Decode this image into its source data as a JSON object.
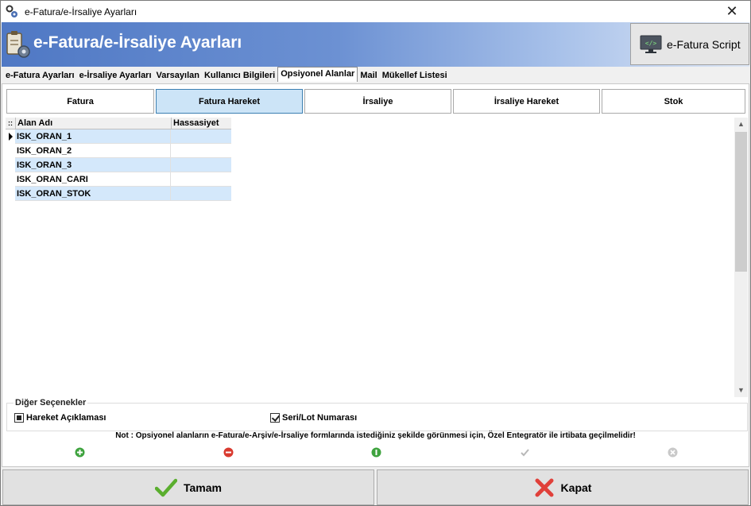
{
  "window": {
    "title": "e-Fatura/e-İrsaliye Ayarları",
    "close_label": "✕"
  },
  "header": {
    "title": "e-Fatura/e-İrsaliye Ayarları",
    "script_button": "e-Fatura Script"
  },
  "tabs": [
    {
      "label": "e-Fatura Ayarları"
    },
    {
      "label": "e-İrsaliye Ayarları"
    },
    {
      "label": "Varsayılan"
    },
    {
      "label": "Kullanıcı Bilgileri"
    },
    {
      "label": "Opsiyonel Alanlar",
      "active": true
    },
    {
      "label": "Mail"
    },
    {
      "label": "Mükellef Listesi"
    }
  ],
  "subtabs": [
    {
      "label": "Fatura"
    },
    {
      "label": "Fatura Hareket",
      "active": true
    },
    {
      "label": "İrsaliye"
    },
    {
      "label": "İrsaliye Hareket"
    },
    {
      "label": "Stok"
    }
  ],
  "grid": {
    "columns": [
      "Alan Adı",
      "Hassasiyet"
    ],
    "rows": [
      {
        "alan": "ISK_ORAN_1",
        "hassasiyet": ""
      },
      {
        "alan": "ISK_ORAN_2",
        "hassasiyet": ""
      },
      {
        "alan": "ISK_ORAN_3",
        "hassasiyet": ""
      },
      {
        "alan": "ISK_ORAN_CARI",
        "hassasiyet": ""
      },
      {
        "alan": "ISK_ORAN_STOK",
        "hassasiyet": ""
      }
    ]
  },
  "options": {
    "legend": "Diğer Seçenekler",
    "hareket_aciklamasi": "Hareket Açıklaması",
    "seri_lot": "Seri/Lot Numarası"
  },
  "note": "Not : Opsiyonel alanların e-Fatura/e-Arşiv/e-İrsaliye formlarında istediğiniz şekilde görünmesi için, Özel Entegratör ile irtibata geçilmelidir!",
  "buttons": {
    "ok": "Tamam",
    "close": "Kapat"
  },
  "colors": {
    "accent": "#4f78c4",
    "selected_row": "#d4e8fb",
    "active_subtab": "#cce4f7"
  }
}
